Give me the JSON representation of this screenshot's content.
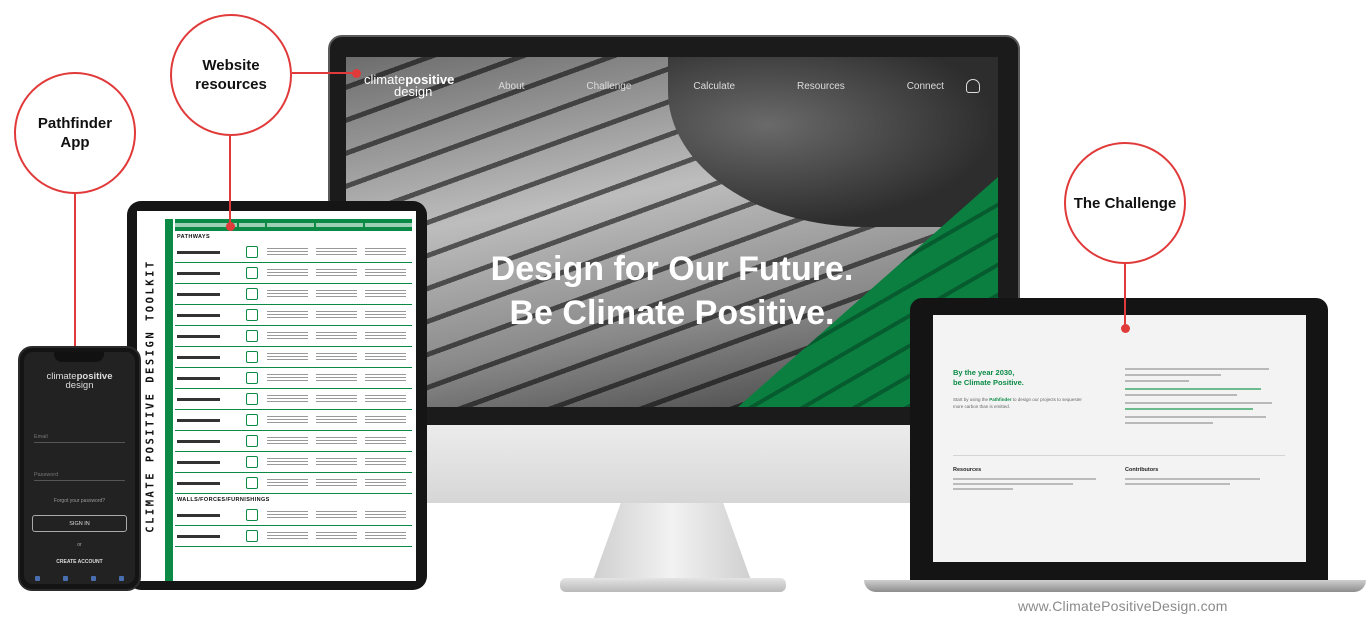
{
  "callouts": {
    "pathfinder": "Pathfinder\nApp",
    "website": "Website\nresources",
    "challenge": "The Challenge"
  },
  "accent_color": "#e13a3a",
  "brand_green": "#0a8a45",
  "website": {
    "brand_line1_a": "climate",
    "brand_line1_b": "positive",
    "brand_line2": "design",
    "nav": [
      "About",
      "Challenge",
      "Calculate",
      "Resources",
      "Connect"
    ],
    "user_icon": "user-icon",
    "hero_line1": "Design for Our Future.",
    "hero_line2": "Be Climate Positive."
  },
  "tablet": {
    "vertical_title": "CLIMATE POSITIVE DESIGN TOOLKIT",
    "section1": "PATHWAYS",
    "section2": "WALLS/FORCES/FURNISHINGS"
  },
  "phone": {
    "brand_a": "climate",
    "brand_b": "positive",
    "brand_c": "design",
    "email_placeholder": "Email",
    "password_placeholder": "Password",
    "forgot": "Forgot your password?",
    "sign_in": "SIGN IN",
    "or": "or",
    "create": "CREATE ACCOUNT"
  },
  "laptop": {
    "title_line1": "By the year 2030,",
    "title_line2": "be Climate Positive.",
    "body_a": "Start by using the ",
    "body_b": "Pathfinder",
    "body_c": " to design our projects to sequester more carbon than is emitted.",
    "resources": "Resources",
    "contributors": "Contributors"
  },
  "footer_url": "www.ClimatePositiveDesign.com"
}
